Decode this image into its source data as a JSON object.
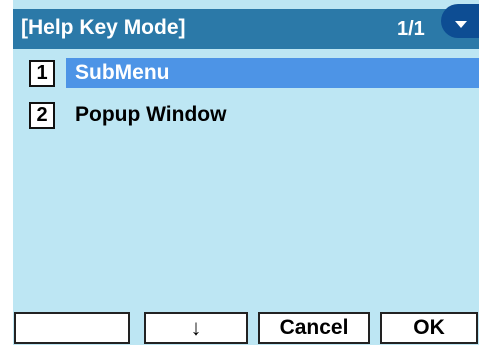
{
  "header": {
    "title": "[Help Key Mode]",
    "page_indicator": "1/1",
    "scroll_icon": "scroll-down-icon"
  },
  "menu": {
    "items": [
      {
        "number": "1",
        "label": "SubMenu",
        "selected": true
      },
      {
        "number": "2",
        "label": "Popup Window",
        "selected": false
      }
    ]
  },
  "softkeys": {
    "key1": "",
    "key2": "↓",
    "key3": "Cancel",
    "key4": "OK"
  },
  "colors": {
    "background": "#bde6f3",
    "titlebar": "#2b79a8",
    "highlight": "#4d94e6",
    "scroll_indicator": "#0d4d93"
  }
}
